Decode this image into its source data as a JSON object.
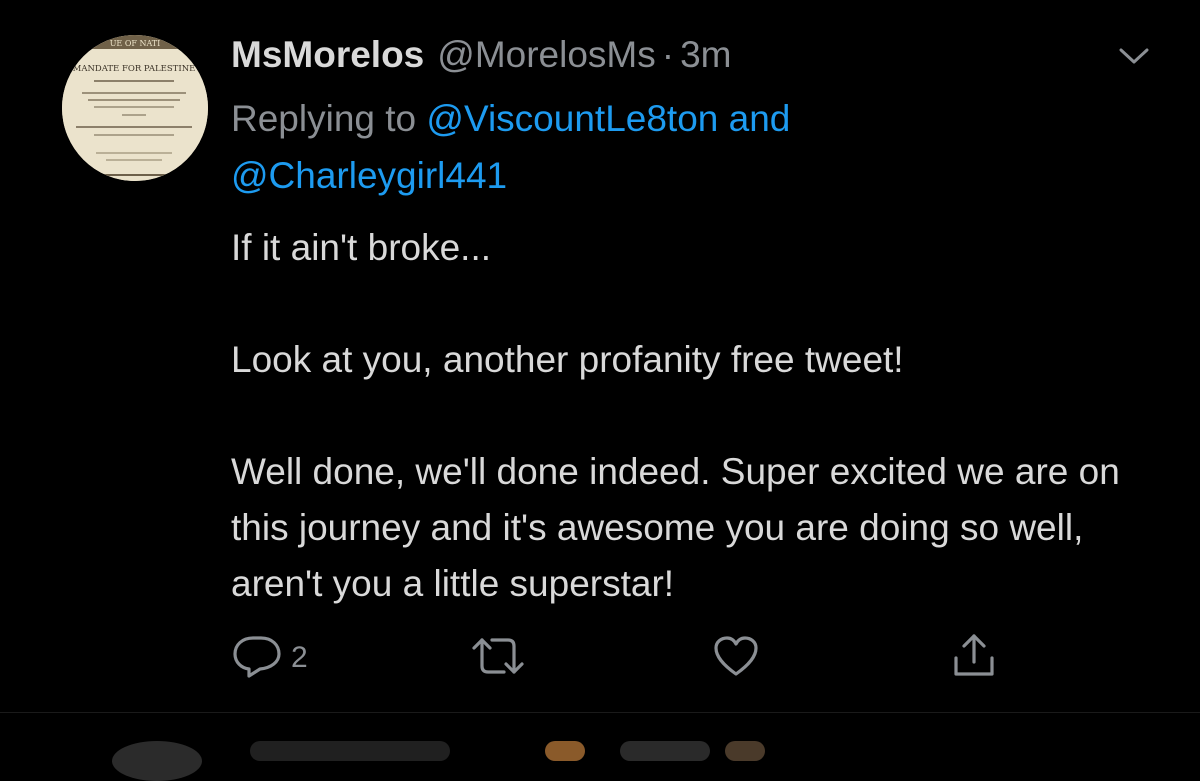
{
  "tweet": {
    "avatar_caption": "MANDATE FOR PALESTINE",
    "display_name": "MsMorelos",
    "handle": "@MorelosMs",
    "separator": "·",
    "time": "3m",
    "replying_prefix": "Replying to",
    "mention_1": "@ViscountLe8ton",
    "replying_and": "and",
    "mention_2": "@Charleygirl441",
    "body": {
      "line_1": "If it ain't broke...",
      "line_2": "Look at you, another profanity free tweet!",
      "line_3": "Well done, we'll done indeed. Super excited we are on this journey and it's awesome you are doing so well, aren't you a little superstar!"
    },
    "actions": {
      "reply_icon": "reply-icon",
      "reply_count": "2",
      "retweet_icon": "retweet-icon",
      "like_icon": "like-icon",
      "share_icon": "share-icon"
    }
  },
  "colors": {
    "background": "#000000",
    "text": "#d9d9d9",
    "muted": "#8b8f94",
    "link": "#1d9bf0"
  }
}
